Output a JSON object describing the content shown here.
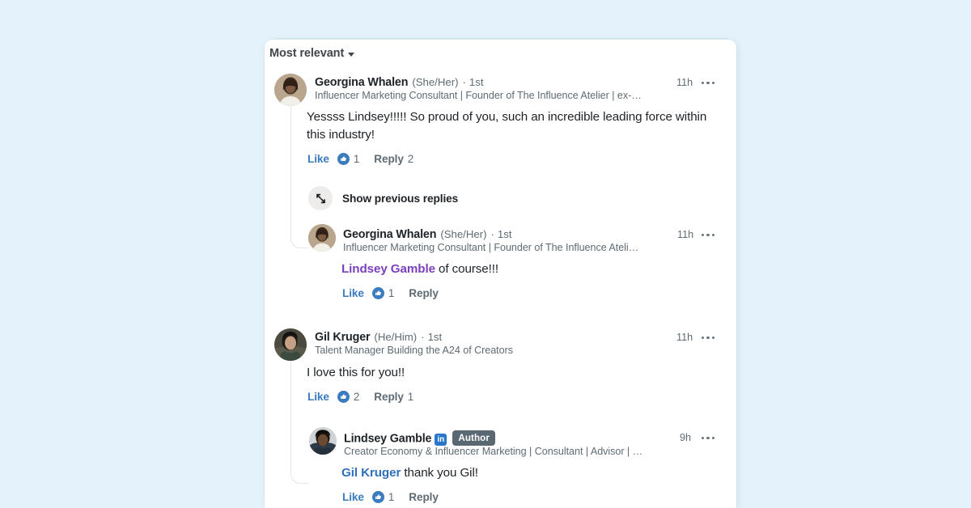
{
  "page": {
    "background_color": "#e3f2fb",
    "card_background": "#ffffff",
    "watermark": "",
    "accent_link": "#3b7bbf",
    "mention_visited": "#7a3fbe",
    "mention_color": "#2f6fbb",
    "author_badge_color": "#5a6871"
  },
  "sort": {
    "label": "Most relevant",
    "icon": "chevron-down-icon"
  },
  "comments": [
    {
      "id": "comment-georgina-top",
      "author": "Georgina Whalen",
      "pronouns": "(She/Her)",
      "separator": "·",
      "degree": "1st",
      "headline": "Influencer Marketing Consultant | Founder of The Influence Atelier | ex-…",
      "time": "11h",
      "text": "Yessss Lindsey!!!!! So proud of you, such an incredible leading force within this industry!",
      "like_label": "Like",
      "reaction_count": "1",
      "reply_label": "Reply",
      "reply_count": "2",
      "menu": "more-options-icon"
    },
    {
      "id": "comment-georgina-reply",
      "author": "Georgina Whalen",
      "pronouns": "(She/Her)",
      "separator": "·",
      "degree": "1st",
      "headline": "Influencer Marketing Consultant | Founder of The Influence Ateli…",
      "time": "11h",
      "mention": "Lindsey Gamble",
      "text_after_mention": " of course!!!",
      "like_label": "Like",
      "reaction_count": "1",
      "reply_label": "Reply",
      "reply_count": "",
      "menu": "more-options-icon"
    },
    {
      "id": "comment-gil-kruger",
      "author": "Gil Kruger",
      "pronouns": "(He/Him)",
      "separator": "·",
      "degree": "1st",
      "headline": "Talent Manager Building the A24 of Creators",
      "time": "11h",
      "text": "I love this for you!!",
      "like_label": "Like",
      "reaction_count": "2",
      "reply_label": "Reply",
      "reply_count": "1",
      "menu": "more-options-icon"
    },
    {
      "id": "comment-lindsey-gamble",
      "author": "Lindsey Gamble",
      "verified_icon": "linkedin-in-icon",
      "verified_glyph": "in",
      "badge": "Author",
      "headline": "Creator Economy & Influencer Marketing | Consultant | Advisor | …",
      "time": "9h",
      "mention": "Gil Kruger",
      "text_after_mention": " thank you Gil!",
      "like_label": "Like",
      "reaction_count": "1",
      "reply_label": "Reply",
      "reply_count": "",
      "menu": "more-options-icon"
    }
  ],
  "show_previous_replies": {
    "label": "Show previous replies",
    "icon": "expand-arrows-icon"
  }
}
